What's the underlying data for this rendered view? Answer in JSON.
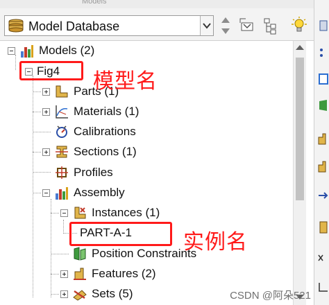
{
  "window": {
    "tab_label": "Models"
  },
  "toolbar": {
    "database_selector": "Model Database",
    "buttons": [
      {
        "icon": "up-down-arrows-icon"
      },
      {
        "icon": "tree-up-icon"
      },
      {
        "icon": "tree-filter-icon"
      },
      {
        "icon": "lightbulb-icon"
      }
    ]
  },
  "tree": {
    "models": {
      "label": "Models (2)",
      "expanded": true
    },
    "model": {
      "label": "Fig4",
      "expanded": true
    },
    "parts": {
      "label": "Parts (1)"
    },
    "materials": {
      "label": "Materials (1)"
    },
    "calibrations": {
      "label": "Calibrations"
    },
    "sections": {
      "label": "Sections (1)"
    },
    "profiles": {
      "label": "Profiles"
    },
    "assembly": {
      "label": "Assembly",
      "expanded": true
    },
    "instances": {
      "label": "Instances (1)",
      "expanded": true
    },
    "instance": {
      "label": "PART-A-1"
    },
    "position_constraints": {
      "label": "Position Constraints"
    },
    "features": {
      "label": "Features (2)"
    },
    "sets": {
      "label": "Sets (5)"
    }
  },
  "annotations": {
    "model_name": "模型名",
    "instance_name": "实例名",
    "color": "#ff1a1a"
  },
  "watermark": "CSDN @阿朵521"
}
